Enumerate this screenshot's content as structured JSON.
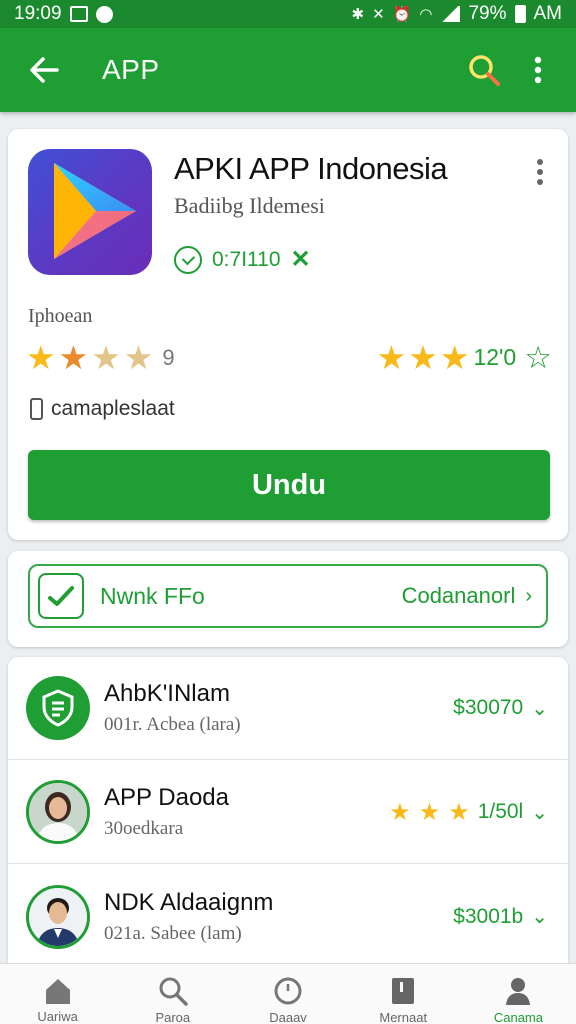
{
  "status_bar": {
    "time": "19:09",
    "battery": "79%",
    "ampm": "AM"
  },
  "app_bar": {
    "title": "APP"
  },
  "app": {
    "name": "APKI APP Indonesia",
    "developer": "Badiibg Ildemesi",
    "version": "0:7I110",
    "section_label": "Iphoean",
    "rating_count_left": "9",
    "rating_value_right": "12'0",
    "requirement": "camapleslaat",
    "install_label": "Undu"
  },
  "promo": {
    "label": "Nwnk FFo",
    "action": "Codananorl"
  },
  "list": [
    {
      "title": "AhbK'INlam",
      "subtitle": "001r. Acbea  (lara)",
      "right": "$30070"
    },
    {
      "title": "APP Daoda",
      "subtitle": "30oedkara",
      "right": "1/50l"
    },
    {
      "title": "NDK Aldaaignm",
      "subtitle": "021a. Sabee  (lam)",
      "right": "$3001b"
    }
  ],
  "bottom_nav": [
    {
      "label": "Uariwa",
      "icon": "home-icon"
    },
    {
      "label": "Paroa",
      "icon": "search-icon"
    },
    {
      "label": "Daaav",
      "icon": "clock-icon"
    },
    {
      "label": "Mernaat",
      "icon": "book-icon"
    },
    {
      "label": "Canama",
      "icon": "person-icon"
    }
  ],
  "colors": {
    "primary": "#1e9e33",
    "status_bar": "#1b8a2e",
    "star": "#f9b919"
  }
}
